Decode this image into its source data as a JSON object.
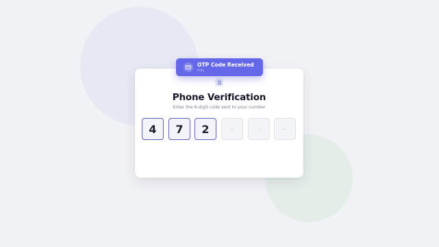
{
  "card": {
    "icon": "lock-icon",
    "title": "Phone Verification",
    "subtitle": "Enter the 6-digit code sent to your number"
  },
  "otp": {
    "digits": [
      "4",
      "7",
      "2",
      "",
      "",
      ""
    ],
    "empty_placeholder": "—"
  },
  "toast": {
    "icon": "mail-icon",
    "title": "OTP Code Received",
    "time": "9:41"
  },
  "colors": {
    "accent": "#6467e8",
    "filled_border": "#5d60b8",
    "background": "#f1f2f5",
    "card": "#ffffff",
    "heading": "#161a2b"
  }
}
